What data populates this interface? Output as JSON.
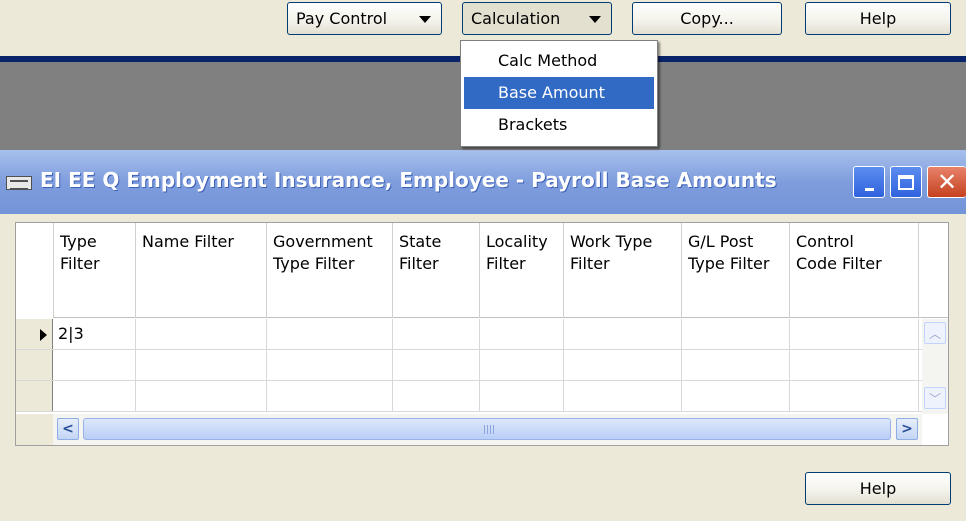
{
  "toolbar": {
    "pay_control": "Pay Control",
    "calculation": "Calculation",
    "copy": "Copy...",
    "help": "Help"
  },
  "menu": {
    "items": [
      {
        "label": "Calc Method",
        "selected": false
      },
      {
        "label": "Base Amount",
        "selected": true
      },
      {
        "label": "Brackets",
        "selected": false
      }
    ]
  },
  "window": {
    "title": "EI EE Q Employment Insurance, Employee - Payroll Base Amounts"
  },
  "grid": {
    "columns": [
      {
        "line1": "Type",
        "line2": "Filter"
      },
      {
        "line1": "",
        "line2": "Name Filter"
      },
      {
        "line1": "Government",
        "line2": "Type Filter"
      },
      {
        "line1": "State",
        "line2": "Filter"
      },
      {
        "line1": "Locality",
        "line2": "Filter"
      },
      {
        "line1": "Work Type",
        "line2": "Filter"
      },
      {
        "line1": "G/L Post",
        "line2": "Type Filter"
      },
      {
        "line1": "Control",
        "line2": "Code Filter"
      }
    ],
    "rows": [
      [
        "2|3",
        "",
        "",
        "",
        "",
        "",
        "",
        ""
      ],
      [
        "",
        "",
        "",
        "",
        "",
        "",
        "",
        ""
      ],
      [
        "",
        "",
        "",
        "",
        "",
        "",
        "",
        ""
      ]
    ]
  },
  "footer": {
    "help": "Help"
  },
  "colors": {
    "title_gradient_start": "#a8c0ec",
    "menu_selection": "#316ac5",
    "form_background": "#ece9d8"
  }
}
